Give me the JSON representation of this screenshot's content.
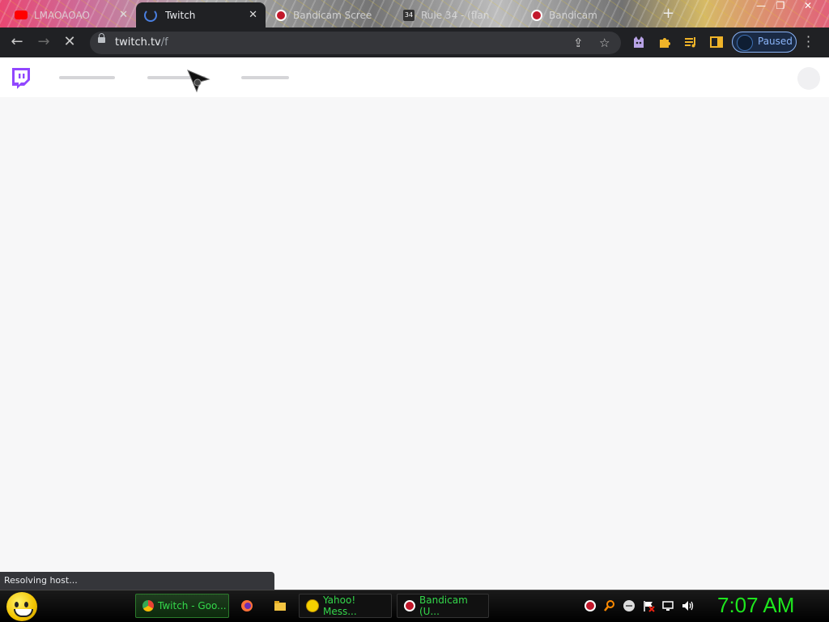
{
  "tabs": [
    {
      "title": "LMAOAOAO",
      "icon": "youtube-icon"
    },
    {
      "title": "Twitch",
      "icon": "loading-spinner-icon",
      "active": true
    },
    {
      "title": "Bandicam Scree",
      "icon": "bandicam-icon"
    },
    {
      "title": "Rule 34 - (flan",
      "icon": "rule34-icon",
      "icon_text": "34"
    },
    {
      "title": "Bandicam",
      "icon": "bandicam-icon"
    }
  ],
  "toolbar": {
    "url_host": "twitch.tv",
    "url_path": "/f",
    "profile_label": "Paused"
  },
  "status_bar": {
    "text": "Resolving host..."
  },
  "taskbar": {
    "items": [
      {
        "label": "Twitch - Goo..."
      },
      {
        "label": "Yahoo! Mess..."
      },
      {
        "label": "Bandicam (U..."
      }
    ],
    "clock": "7:07 AM"
  },
  "colors": {
    "twitch_purple": "#9147ff",
    "toolbar_bg": "#202124",
    "clock_green": "#1ee61e",
    "task_text_green": "#34d84b",
    "paused_blue": "#8ab4f8"
  }
}
